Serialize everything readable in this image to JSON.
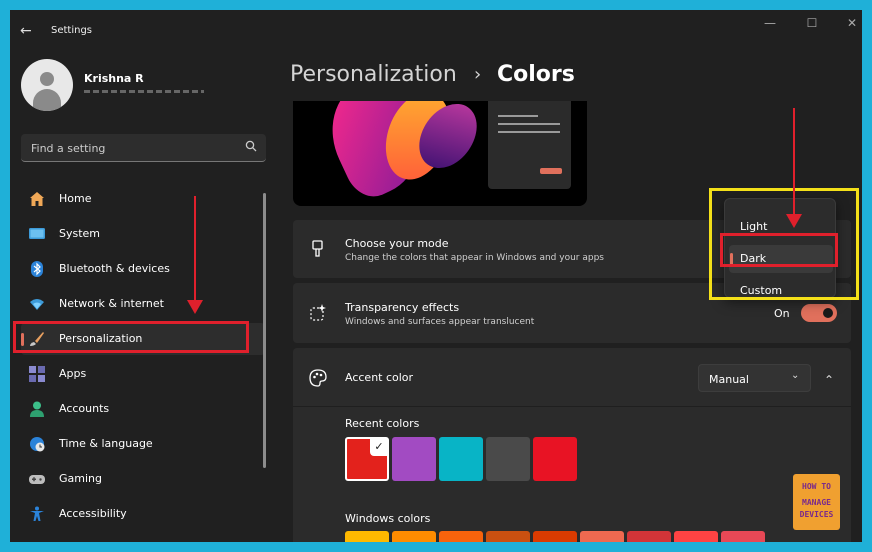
{
  "window": {
    "title": "Settings",
    "back_glyph": "←",
    "minimize_glyph": "—",
    "maximize_glyph": "☐",
    "close_glyph": "✕"
  },
  "profile": {
    "name": "Krishna R"
  },
  "search": {
    "placeholder": "Find a setting",
    "icon": "search-icon"
  },
  "sidebar": {
    "items": [
      {
        "label": "Home",
        "icon": "home-icon"
      },
      {
        "label": "System",
        "icon": "display-icon"
      },
      {
        "label": "Bluetooth & devices",
        "icon": "bluetooth-icon"
      },
      {
        "label": "Network & internet",
        "icon": "wifi-icon"
      },
      {
        "label": "Personalization",
        "icon": "brush-icon",
        "selected": true
      },
      {
        "label": "Apps",
        "icon": "apps-icon"
      },
      {
        "label": "Accounts",
        "icon": "person-icon"
      },
      {
        "label": "Time & language",
        "icon": "globe-clock-icon"
      },
      {
        "label": "Gaming",
        "icon": "gamepad-icon"
      },
      {
        "label": "Accessibility",
        "icon": "accessibility-icon"
      }
    ]
  },
  "breadcrumb": {
    "parent": "Personalization",
    "separator": "›",
    "current": "Colors"
  },
  "cards": {
    "mode": {
      "title": "Choose your mode",
      "description": "Change the colors that appear in Windows and your apps"
    },
    "transparency": {
      "title": "Transparency effects",
      "description": "Windows and surfaces appear translucent",
      "toggle_label": "On",
      "toggle_on": true
    },
    "accent": {
      "title": "Accent color",
      "selected_option": "Manual",
      "dropdown_glyph": "⌄",
      "expand_glyph": "⌃",
      "recent_label": "Recent colors",
      "recent_colors": [
        "#e3221c",
        "#a24bc2",
        "#08b4c6",
        "#4a4a4a",
        "#e81324"
      ],
      "windows_label": "Windows colors",
      "windows_colors": [
        "#ffb900",
        "#ff8c00",
        "#f7630c",
        "#ca5010",
        "#da3b01",
        "#ef6950",
        "#d13438",
        "#ff4343",
        "#e74856"
      ],
      "check_glyph": "✓"
    }
  },
  "mode_dropdown": {
    "options": [
      "Light",
      "Dark",
      "Custom"
    ],
    "selected": "Dark"
  },
  "logo": {
    "lines": [
      "HOW TO",
      "MANAGE",
      "DEVICES"
    ]
  },
  "colors": {
    "accent": "#e0705c",
    "annotation_red": "#e0202c",
    "annotation_yellow": "#f4e019",
    "background": "#202020",
    "card": "#2b2b2b"
  }
}
